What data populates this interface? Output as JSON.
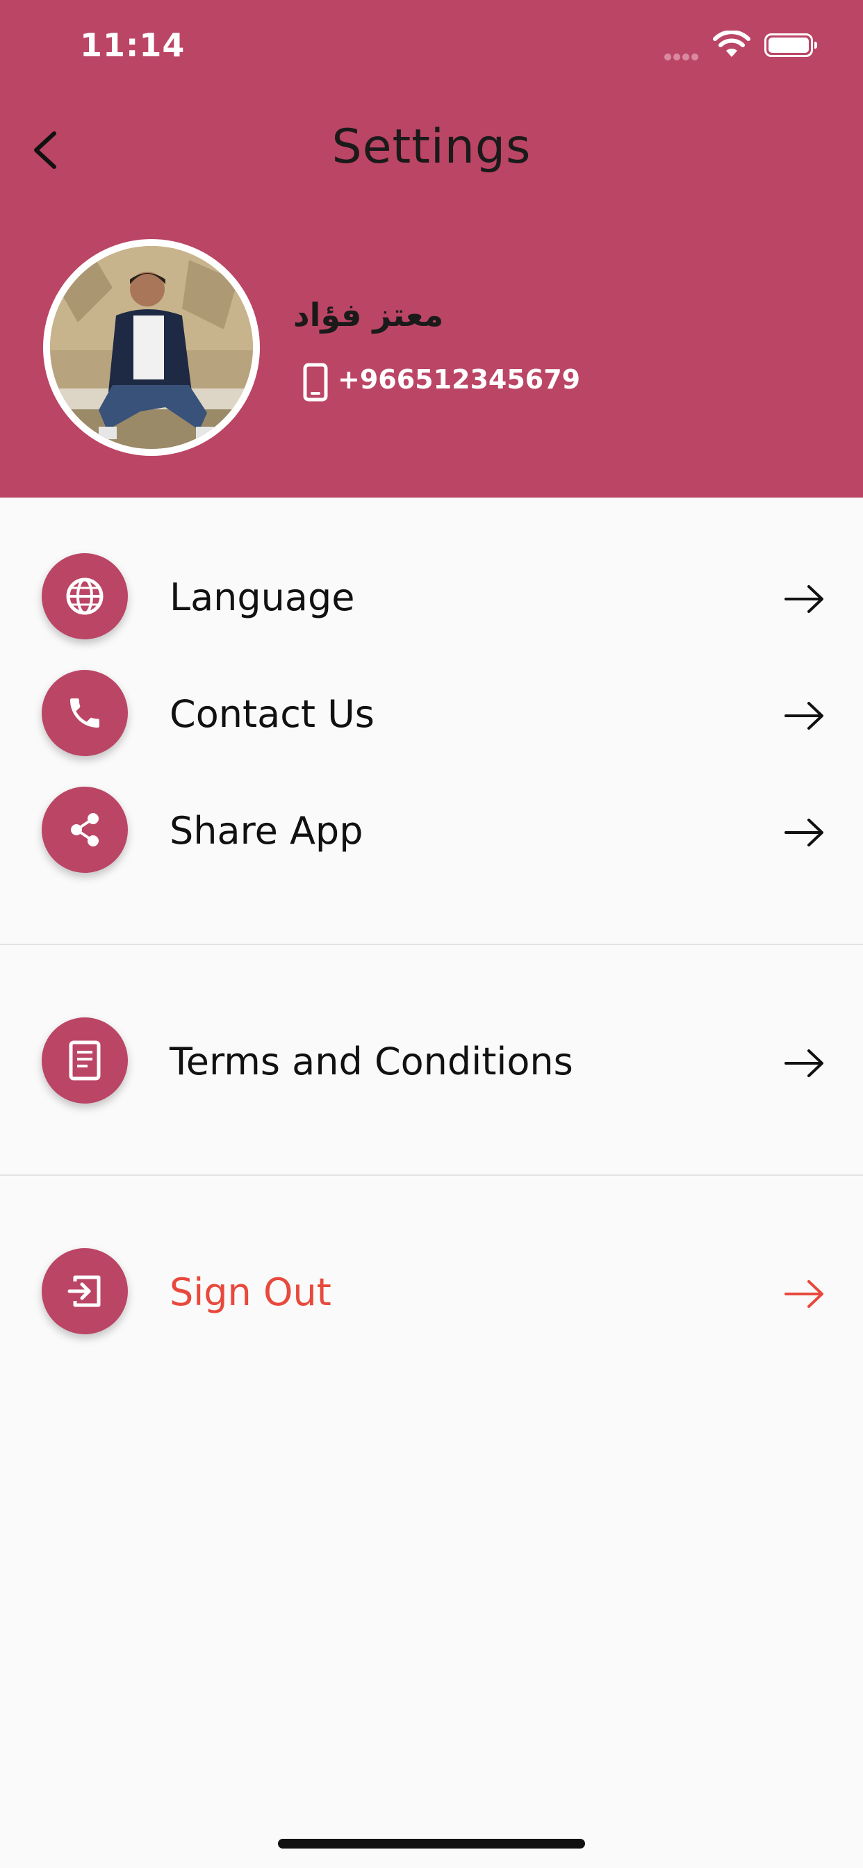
{
  "status_bar": {
    "time": "11:14"
  },
  "header": {
    "title": "Settings",
    "profile": {
      "name": "معتز فؤاد",
      "phone": "+966512345679"
    }
  },
  "menu": {
    "language": "Language",
    "contact_us": "Contact Us",
    "share_app": "Share App",
    "terms": "Terms and Conditions",
    "sign_out": "Sign Out"
  },
  "icons": {
    "language": "globe-icon",
    "contact_us": "phone-icon",
    "share_app": "share-icon",
    "terms": "document-icon",
    "sign_out": "sign-out-icon",
    "row_arrow": "arrow-right-icon"
  },
  "colors": {
    "accent": "#bb4565",
    "sign_out_text": "#e8493d",
    "background": "#fafafa"
  }
}
